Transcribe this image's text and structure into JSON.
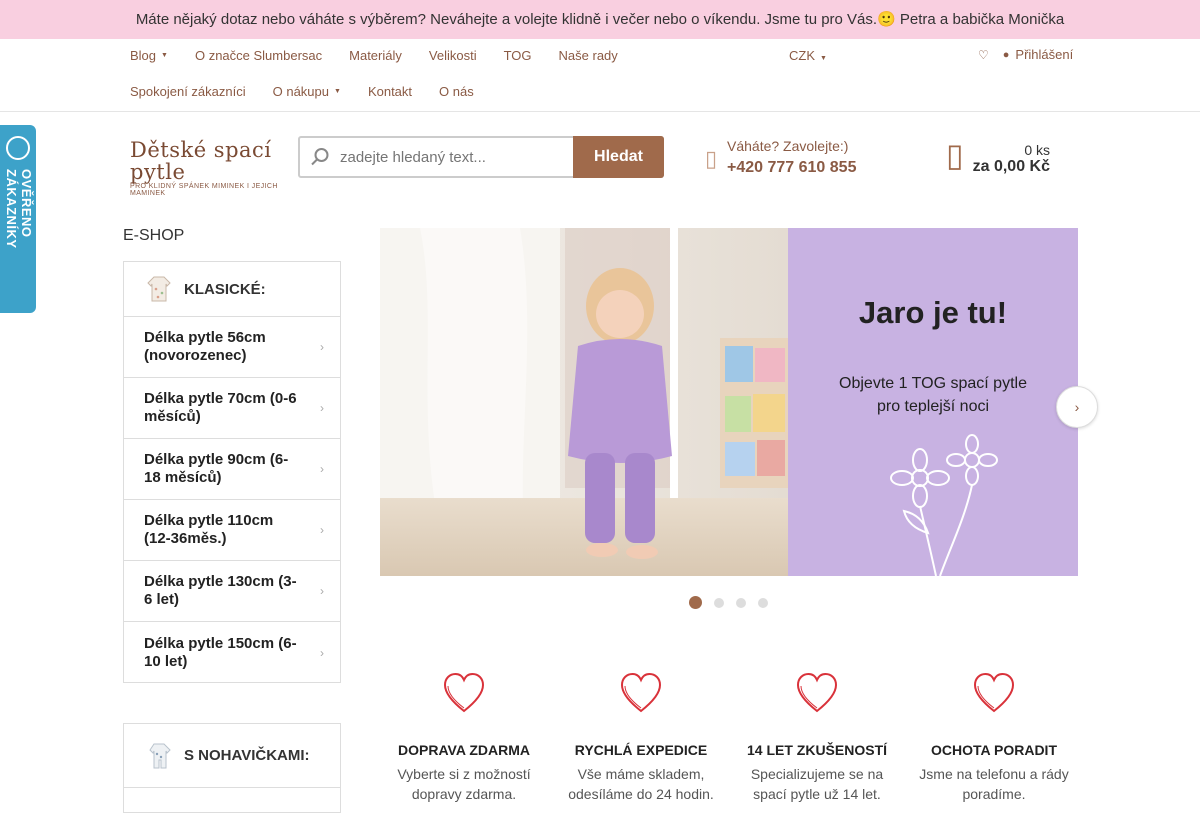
{
  "topbar": {
    "message": "Máte nějaký dotaz nebo váháte s výběrem? Neváhejte a volejte klidně i večer nebo o víkendu. Jsme tu pro Vás.🙂 Petra a babička Monička"
  },
  "nav": {
    "row1": [
      {
        "label": "Blog",
        "caret": true
      },
      {
        "label": "O značce Slumbersac",
        "caret": false
      },
      {
        "label": "Materiály",
        "caret": false
      },
      {
        "label": "Velikosti",
        "caret": false
      },
      {
        "label": "TOG",
        "caret": false
      },
      {
        "label": "Naše rady",
        "caret": false
      }
    ],
    "row2": [
      {
        "label": "Spokojení zákazníci",
        "caret": false
      },
      {
        "label": "O nákupu",
        "caret": true
      },
      {
        "label": "Kontakt",
        "caret": false
      },
      {
        "label": "O nás",
        "caret": false
      }
    ],
    "currency": "CZK",
    "login": "Přihlášení"
  },
  "logo": {
    "title": "Dětské spací pytle",
    "tagline": "PRO KLIDNÝ SPÁNEK MIMINEK I JEJICH MAMINEK"
  },
  "search": {
    "placeholder": "zadejte hledaný text...",
    "button": "Hledat"
  },
  "contact": {
    "question": "Váháte? Zavolejte:)",
    "phone": "+420 777 610 855"
  },
  "cart": {
    "count": "0 ks",
    "total": "za 0,00 Kč"
  },
  "badge": {
    "text": "OVĚŘENO ZÁKAZNÍKY"
  },
  "sidebar": {
    "heading": "E-SHOP",
    "group1": {
      "label": "KLASICKÉ:",
      "items": [
        "Délka pytle 56cm (novorozenec)",
        "Délka pytle 70cm (0-6 měsíců)",
        "Délka pytle 90cm (6-18 měsíců)",
        "Délka pytle 110cm (12-36měs.)",
        "Délka pytle 130cm (3-6 let)",
        "Délka pytle 150cm (6-10 let)"
      ]
    },
    "group2": {
      "label": "S NOHAVIČKAMI:"
    }
  },
  "banner": {
    "headline": "Jaro je tu!",
    "line1": "Objevte 1 TOG spací pytle",
    "line2": "pro teplejší noci",
    "slides": 4,
    "active_slide": 1
  },
  "features": [
    {
      "title": "DOPRAVA ZDARMA",
      "line1": "Vyberte si z možností",
      "line2": "dopravy zdarma."
    },
    {
      "title": "RYCHLÁ EXPEDICE",
      "line1": "Vše máme skladem,",
      "line2": "odesíláme do 24 hodin."
    },
    {
      "title": "14 LET ZKUŠENOSTÍ",
      "line1": "Specializujeme se na",
      "line2": "spací pytle už 14 let."
    },
    {
      "title": "OCHOTA PORADIT",
      "line1": "Jsme na telefonu a rády",
      "line2": "poradíme."
    }
  ],
  "colors": {
    "accent": "#a06a4b",
    "topbar": "#f9cfe0",
    "badge": "#3da2c9",
    "banner_purple": "#c8b2e2"
  },
  "icons": {
    "search": "search-icon",
    "phone": "phone-icon",
    "cart": "cart-icon",
    "next": "chevron-right-icon",
    "feature": "heart-icon"
  }
}
